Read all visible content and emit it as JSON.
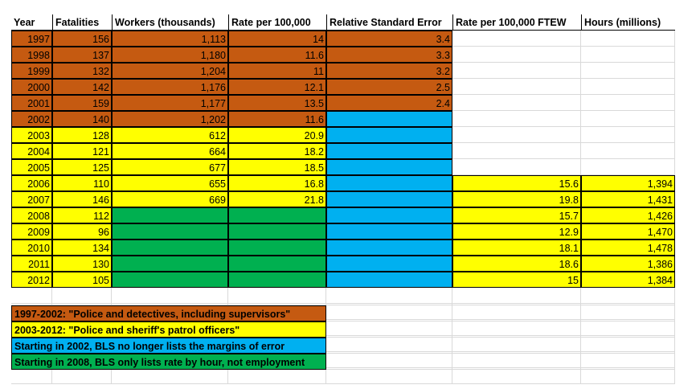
{
  "colors": {
    "orange": "#c55a11",
    "yellow": "#ffff00",
    "blue": "#00b0f0",
    "green": "#00b050"
  },
  "table": {
    "headers": [
      "Year",
      "Fatalities",
      "Workers (thousands)",
      "Rate per 100,000",
      "Relative Standard Error",
      "Rate per 100,000 FTEW",
      "Hours (millions)"
    ],
    "rows": [
      {
        "year": "1997",
        "fatalities": "156",
        "workers": "1,113",
        "rate": "14",
        "rse": "3.4",
        "ftew": "",
        "hours": ""
      },
      {
        "year": "1998",
        "fatalities": "137",
        "workers": "1,180",
        "rate": "11.6",
        "rse": "3.3",
        "ftew": "",
        "hours": ""
      },
      {
        "year": "1999",
        "fatalities": "132",
        "workers": "1,204",
        "rate": "11",
        "rse": "3.2",
        "ftew": "",
        "hours": ""
      },
      {
        "year": "2000",
        "fatalities": "142",
        "workers": "1,176",
        "rate": "12.1",
        "rse": "2.5",
        "ftew": "",
        "hours": ""
      },
      {
        "year": "2001",
        "fatalities": "159",
        "workers": "1,177",
        "rate": "13.5",
        "rse": "2.4",
        "ftew": "",
        "hours": ""
      },
      {
        "year": "2002",
        "fatalities": "140",
        "workers": "1,202",
        "rate": "11.6",
        "rse": "",
        "ftew": "",
        "hours": ""
      },
      {
        "year": "2003",
        "fatalities": "128",
        "workers": "612",
        "rate": "20.9",
        "rse": "",
        "ftew": "",
        "hours": ""
      },
      {
        "year": "2004",
        "fatalities": "121",
        "workers": "664",
        "rate": "18.2",
        "rse": "",
        "ftew": "",
        "hours": ""
      },
      {
        "year": "2005",
        "fatalities": "125",
        "workers": "677",
        "rate": "18.5",
        "rse": "",
        "ftew": "",
        "hours": ""
      },
      {
        "year": "2006",
        "fatalities": "110",
        "workers": "655",
        "rate": "16.8",
        "rse": "",
        "ftew": "15.6",
        "hours": "1,394"
      },
      {
        "year": "2007",
        "fatalities": "146",
        "workers": "669",
        "rate": "21.8",
        "rse": "",
        "ftew": "19.8",
        "hours": "1,431"
      },
      {
        "year": "2008",
        "fatalities": "112",
        "workers": "",
        "rate": "",
        "rse": "",
        "ftew": "15.7",
        "hours": "1,426"
      },
      {
        "year": "2009",
        "fatalities": "96",
        "workers": "",
        "rate": "",
        "rse": "",
        "ftew": "12.9",
        "hours": "1,470"
      },
      {
        "year": "2010",
        "fatalities": "134",
        "workers": "",
        "rate": "",
        "rse": "",
        "ftew": "18.1",
        "hours": "1,478"
      },
      {
        "year": "2011",
        "fatalities": "130",
        "workers": "",
        "rate": "",
        "rse": "",
        "ftew": "18.6",
        "hours": "1,386"
      },
      {
        "year": "2012",
        "fatalities": "105",
        "workers": "",
        "rate": "",
        "rse": "",
        "ftew": "15",
        "hours": "1,384"
      }
    ]
  },
  "legend": [
    {
      "text": "1997-2002: \"Police and detectives, including supervisors\"",
      "color": "orange"
    },
    {
      "text": "2003-2012: \"Police and sheriff's patrol officers\"",
      "color": "yellow"
    },
    {
      "text": "Starting in 2002, BLS no longer lists the margins of error",
      "color": "blue"
    },
    {
      "text": "Starting in 2008, BLS only lists rate by hour, not employment",
      "color": "green"
    }
  ]
}
